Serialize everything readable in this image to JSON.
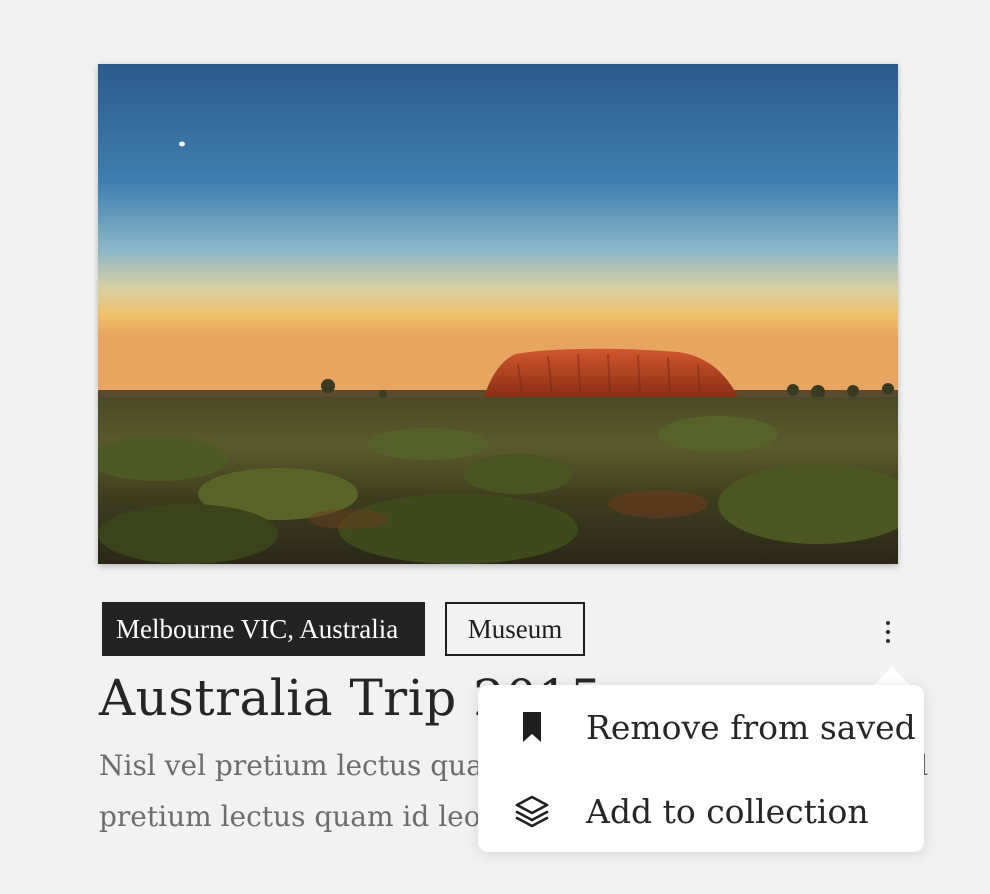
{
  "card": {
    "image_alt": "Uluru at sunset over the outback",
    "tags": {
      "location": "Melbourne VIC, Australia",
      "category": "Museum"
    },
    "title": "Australia Trip 2015",
    "excerpt_lines": [
      "Nisl vel pretium lectus quam id leo in vitae turpis. Nisl vel",
      "pretium lectus quam id leo in vitae turpis."
    ],
    "more_icon": "more-vertical-icon"
  },
  "menu": {
    "items": [
      {
        "icon": "bookmark-icon",
        "label": "Remove from saved"
      },
      {
        "icon": "layers-icon",
        "label": "Add to collection"
      }
    ]
  },
  "colors": {
    "background": "#f2f2f2",
    "tag_dark": "#232323",
    "text_primary": "#262626",
    "text_secondary": "#6d6d6d",
    "menu_bg": "#ffffff"
  }
}
